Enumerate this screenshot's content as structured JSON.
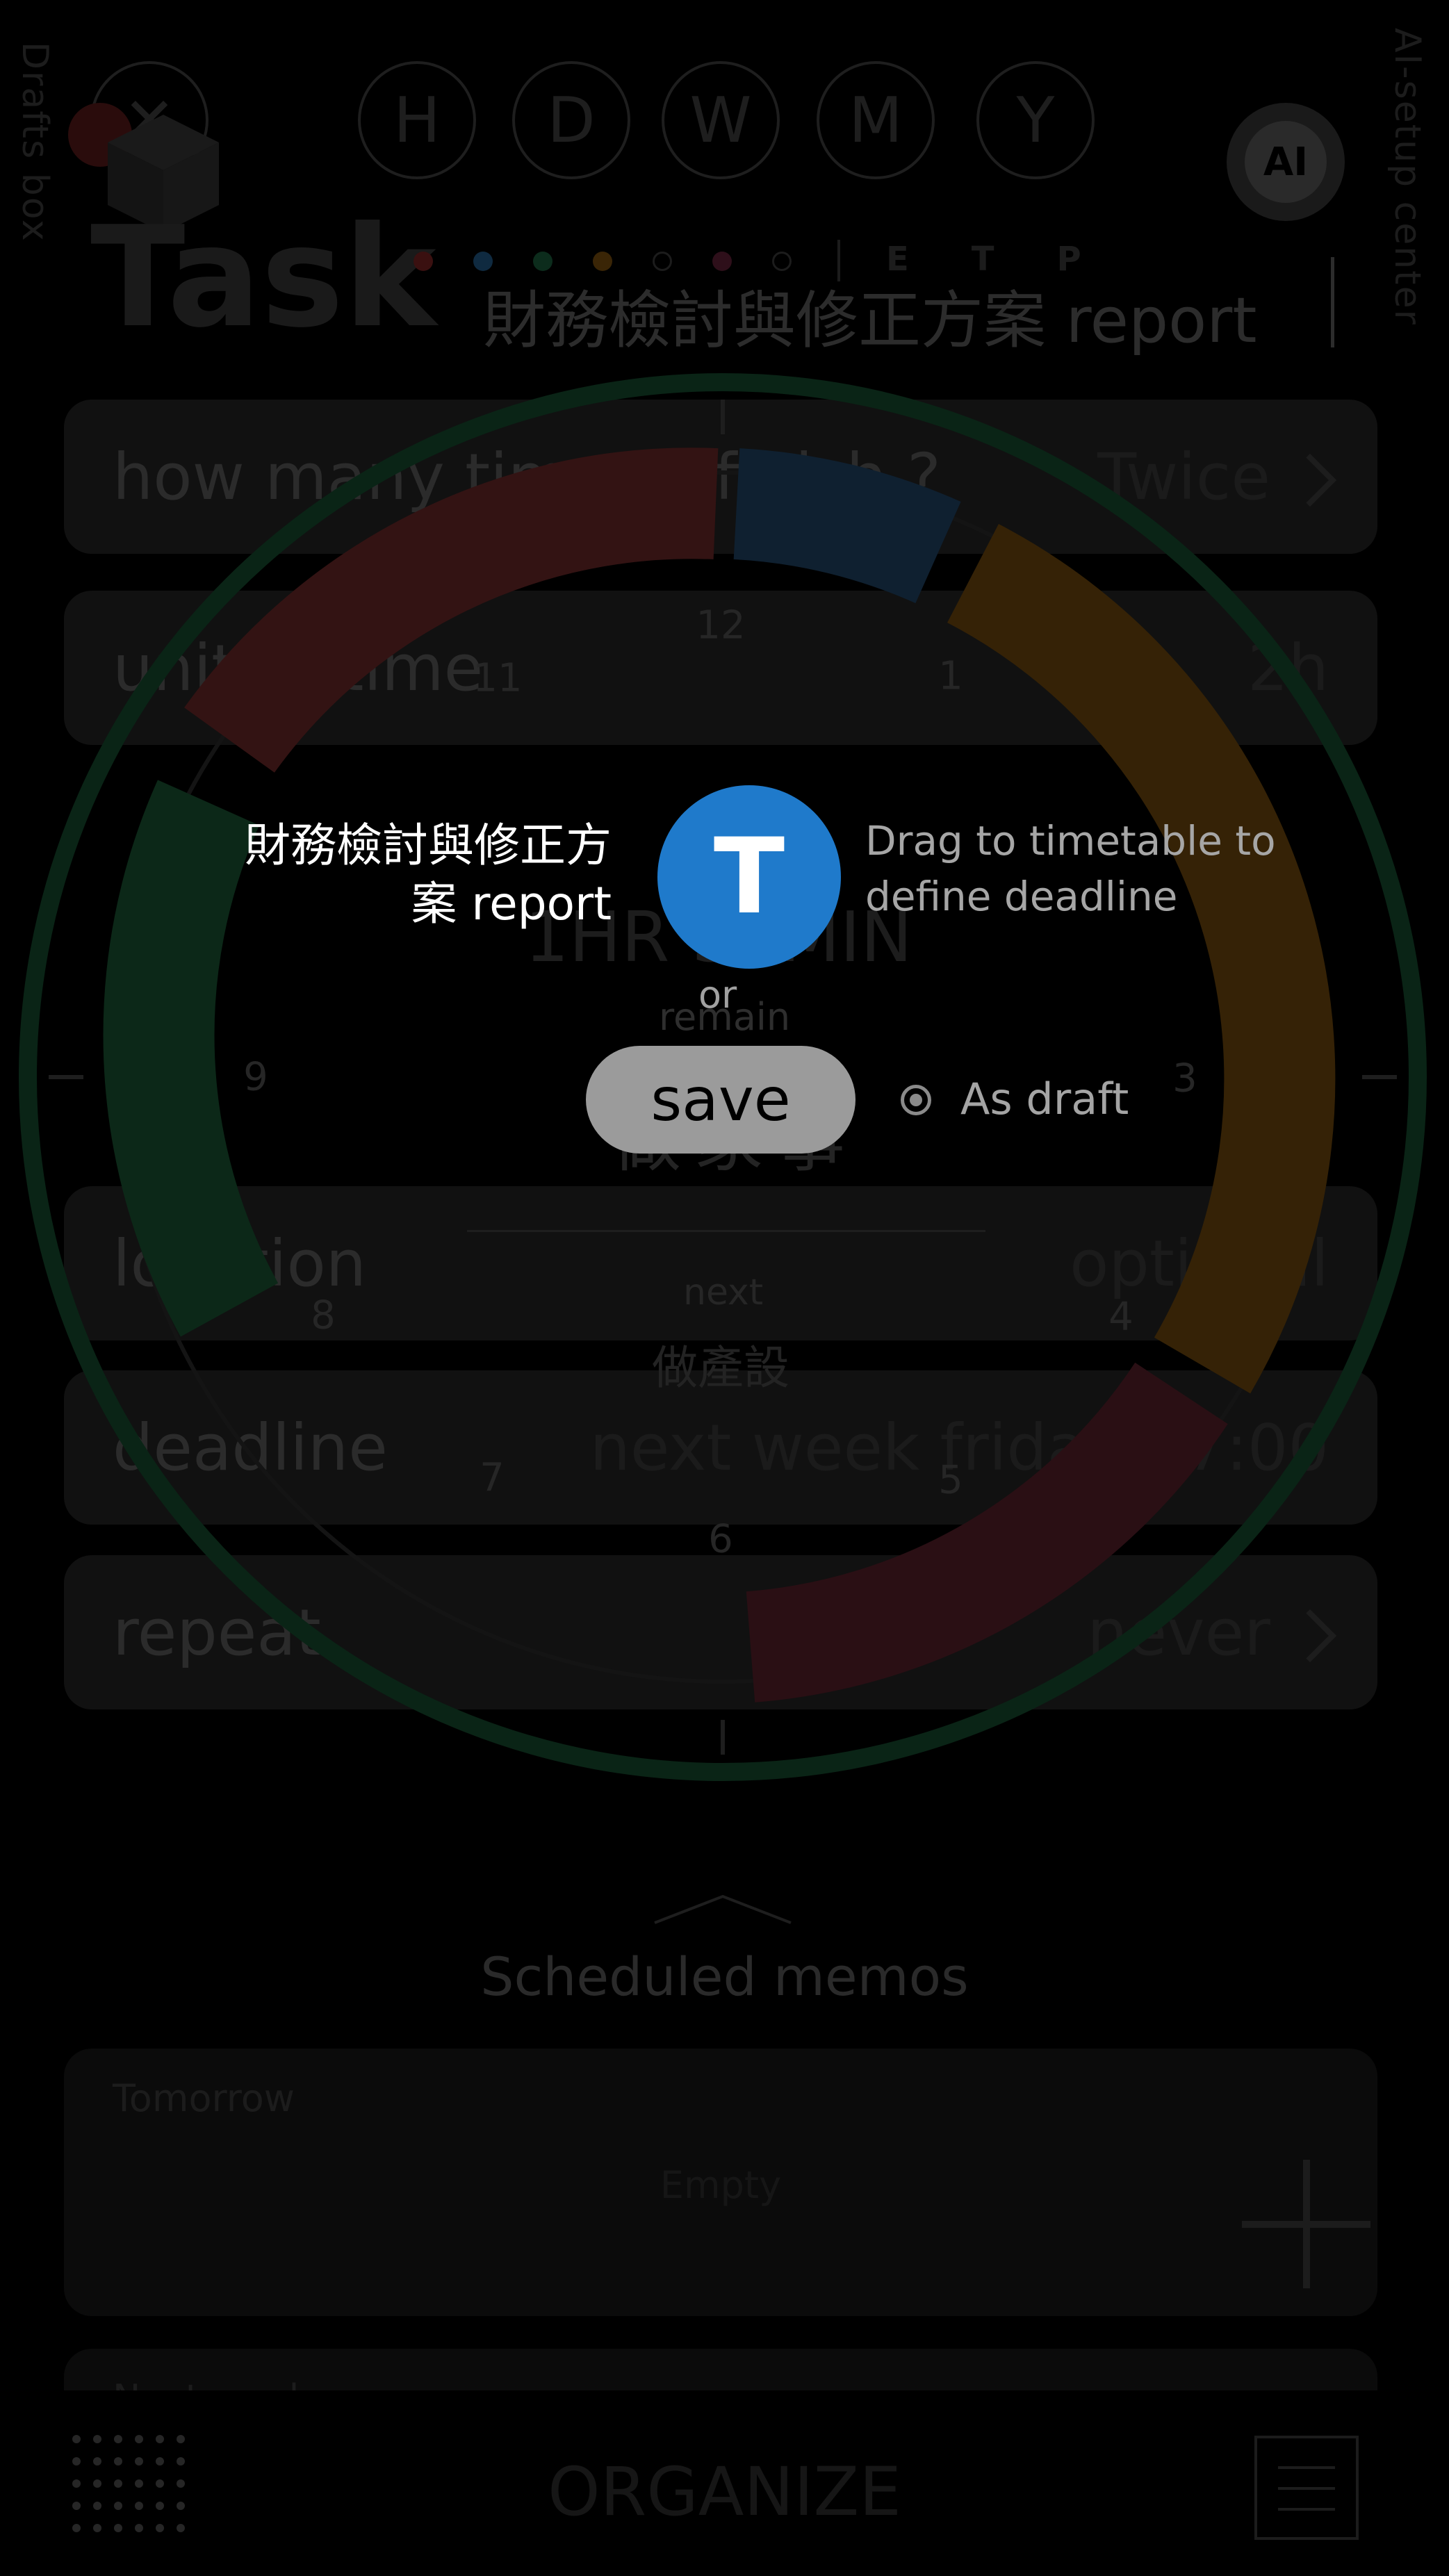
{
  "side": {
    "drafts_box": "Drafts box",
    "ai_setup_center": "AI-setup center"
  },
  "header": {
    "close_glyph": "✕",
    "periods": [
      "H",
      "D",
      "W",
      "M",
      "Y"
    ],
    "ai_badge": "AI",
    "task_word": "Task",
    "mini_letters": [
      "E",
      "T",
      "P"
    ],
    "title_value": "財務檢討與修正方案 report"
  },
  "form": {
    "rows": [
      {
        "label": "how many time to finish ?",
        "value": "Twice",
        "chevron": true
      },
      {
        "label": "unit of time",
        "value": "2h",
        "chevron": false
      },
      {
        "label": "location",
        "value": "optional",
        "chevron": false
      },
      {
        "label": "deadline",
        "value": "next week friday 17:00",
        "chevron": false
      },
      {
        "label": "repeat",
        "value": "never",
        "chevron": true
      }
    ]
  },
  "clock": {
    "numbers": [
      "12",
      "1",
      "3",
      "4",
      "5",
      "6",
      "7",
      "8",
      "9",
      "11"
    ],
    "center_time": "1HR 30MIN",
    "remain_label": "remain",
    "current_activity": "做家事",
    "next_label": "next",
    "next_activity": "做產設",
    "colors": {
      "red": "#3a1414",
      "blue": "#0f2236",
      "orange": "#3b2508",
      "green": "#0a2a1a"
    }
  },
  "memos": {
    "section_title": "Scheduled memos",
    "cards": [
      {
        "heading": "Tomorrow",
        "body": "Empty"
      },
      {
        "heading": "Next week",
        "body": ""
      }
    ]
  },
  "bottom": {
    "organize_label": "ORGANIZE"
  },
  "overlay": {
    "task_title": "財務檢討與修正方案 report",
    "avatar_letter": "T",
    "avatar_color": "#1f7acb",
    "drag_hint": "Drag to timetable to define deadline",
    "or_label": "or",
    "save_label": "save",
    "draft_label": "As draft"
  }
}
